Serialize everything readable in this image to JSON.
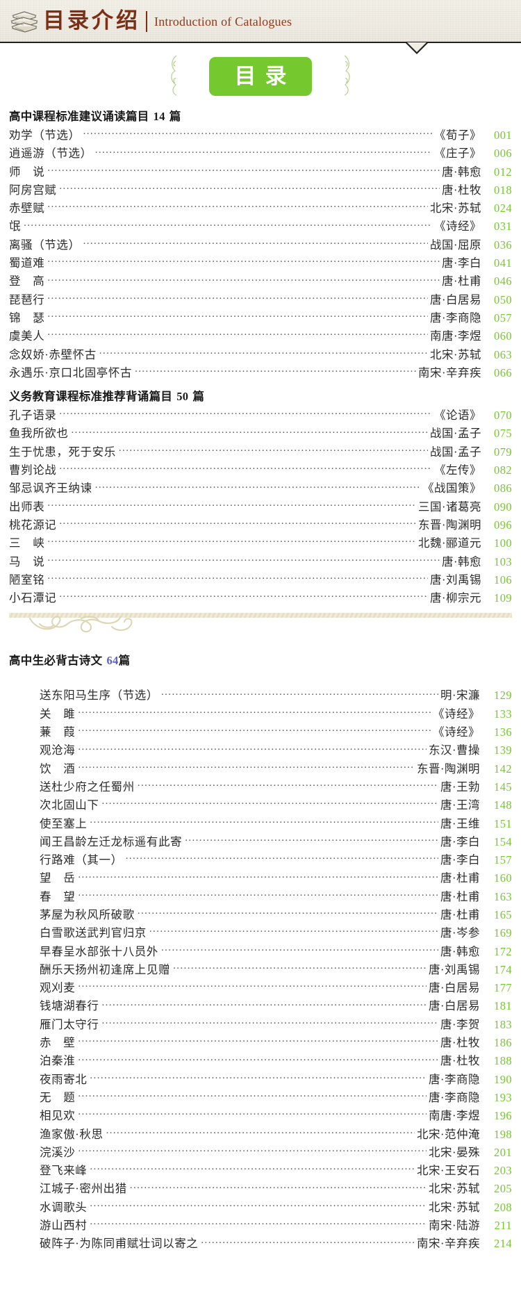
{
  "banner": {
    "title_cn": "目录介绍",
    "title_en": "Introduction of Catalogues",
    "books_icon": "stacked-books-icon"
  },
  "badge": {
    "label": "目录"
  },
  "colors": {
    "green": "#76c82f",
    "brand_brown": "#7b2f16",
    "accent_blue": "#5d5fc8"
  },
  "sections": [
    {
      "title_prefix": "高中课程标准建议诵读篇目 ",
      "title_num": "14",
      "title_suffix": " 篇",
      "entries": [
        {
          "title": "劝学（节选）",
          "author": "《荀子》",
          "page": "001"
        },
        {
          "title": "逍遥游（节选）",
          "author": "《庄子》",
          "page": "006"
        },
        {
          "title": "师　说",
          "author": "唐·韩愈",
          "page": "012"
        },
        {
          "title": "阿房宫赋",
          "author": "唐·杜牧",
          "page": "018"
        },
        {
          "title": "赤壁赋",
          "author": "北宋·苏轼",
          "page": "024"
        },
        {
          "title": "氓",
          "author": "《诗经》",
          "page": "031"
        },
        {
          "title": "离骚（节选）",
          "author": "战国·屈原",
          "page": "036"
        },
        {
          "title": "蜀道难",
          "author": "唐·李白",
          "page": "041"
        },
        {
          "title": "登　高",
          "author": "唐·杜甫",
          "page": "046"
        },
        {
          "title": "琵琶行",
          "author": "唐·白居易",
          "page": "050"
        },
        {
          "title": "锦　瑟",
          "author": "唐·李商隐",
          "page": "057"
        },
        {
          "title": "虞美人",
          "author": "南唐·李煜",
          "page": "060"
        },
        {
          "title": "念奴娇·赤壁怀古",
          "author": "北宋·苏轼",
          "page": "063"
        },
        {
          "title": "永遇乐·京口北固亭怀古",
          "author": "南宋·辛弃疾",
          "page": "066"
        }
      ]
    },
    {
      "title_prefix": "义务教育课程标准推荐背诵篇目 ",
      "title_num": "50",
      "title_suffix": " 篇",
      "entries": [
        {
          "title": "孔子语录",
          "author": "《论语》",
          "page": "070"
        },
        {
          "title": "鱼我所欲也",
          "author": "战国·孟子",
          "page": "075"
        },
        {
          "title": "生于忧患，死于安乐",
          "author": "战国·孟子",
          "page": "079"
        },
        {
          "title": "曹刿论战",
          "author": "《左传》",
          "page": "082"
        },
        {
          "title": "邹忌讽齐王纳谏",
          "author": "《战国策》",
          "page": "086"
        },
        {
          "title": "出师表",
          "author": "三国·诸葛亮",
          "page": "090"
        },
        {
          "title": "桃花源记",
          "author": "东晋·陶渊明",
          "page": "096"
        },
        {
          "title": "三　峡",
          "author": "北魏·郦道元",
          "page": "100"
        },
        {
          "title": "马　说",
          "author": "唐·韩愈",
          "page": "103"
        },
        {
          "title": "陋室铭",
          "author": "唐·刘禹锡",
          "page": "106"
        },
        {
          "title": "小石潭记",
          "author": "唐·柳宗元",
          "page": "109"
        }
      ]
    },
    {
      "title_prefix": "高中生必背古诗文 ",
      "title_num": "64",
      "title_suffix": "篇",
      "entries": [
        {
          "title": "送东阳马生序（节选）",
          "author": "明·宋濂",
          "page": "129"
        },
        {
          "title": "关　雎",
          "author": "《诗经》",
          "page": "133"
        },
        {
          "title": "蒹　葭",
          "author": "《诗经》",
          "page": "136"
        },
        {
          "title": "观沧海",
          "author": "东汉·曹操",
          "page": "139"
        },
        {
          "title": "饮　酒",
          "author": "东晋·陶渊明",
          "page": "142"
        },
        {
          "title": "送杜少府之任蜀州",
          "author": "唐·王勃",
          "page": "145"
        },
        {
          "title": "次北固山下",
          "author": "唐·王湾",
          "page": "148"
        },
        {
          "title": "使至塞上",
          "author": "唐·王维",
          "page": "151"
        },
        {
          "title": "闻王昌龄左迁龙标遥有此寄",
          "author": "唐·李白",
          "page": "154"
        },
        {
          "title": "行路难（其一）",
          "author": "唐·李白",
          "page": "157"
        },
        {
          "title": "望　岳",
          "author": "唐·杜甫",
          "page": "160"
        },
        {
          "title": "春　望",
          "author": "唐·杜甫",
          "page": "163"
        },
        {
          "title": "茅屋为秋风所破歌",
          "author": "唐·杜甫",
          "page": "165"
        },
        {
          "title": "白雪歌送武判官归京",
          "author": "唐·岑参",
          "page": "169"
        },
        {
          "title": "早春呈水部张十八员外",
          "author": "唐·韩愈",
          "page": "172"
        },
        {
          "title": "酬乐天扬州初逢席上见赠",
          "author": "唐·刘禹锡",
          "page": "174"
        },
        {
          "title": "观刈麦",
          "author": "唐·白居易",
          "page": "177"
        },
        {
          "title": "钱塘湖春行",
          "author": "唐·白居易",
          "page": "181"
        },
        {
          "title": "雁门太守行",
          "author": "唐·李贺",
          "page": "183"
        },
        {
          "title": "赤　壁",
          "author": "唐·杜牧",
          "page": "186"
        },
        {
          "title": "泊秦淮",
          "author": "唐·杜牧",
          "page": "188"
        },
        {
          "title": "夜雨寄北",
          "author": "唐·李商隐",
          "page": "190"
        },
        {
          "title": "无　题",
          "author": "唐·李商隐",
          "page": "193"
        },
        {
          "title": "相见欢",
          "author": "南唐·李煜",
          "page": "196"
        },
        {
          "title": "渔家傲·秋思",
          "author": "北宋·范仲淹",
          "page": "198"
        },
        {
          "title": "浣溪沙",
          "author": "北宋·晏殊",
          "page": "201"
        },
        {
          "title": "登飞来峰",
          "author": "北宋·王安石",
          "page": "203"
        },
        {
          "title": "江城子·密州出猎",
          "author": "北宋·苏轼",
          "page": "205"
        },
        {
          "title": "水调歌头",
          "author": "北宋·苏轼",
          "page": "208"
        },
        {
          "title": "游山西村",
          "author": "南宋·陆游",
          "page": "211"
        },
        {
          "title": "破阵子·为陈同甫赋壮词以寄之",
          "author": "南宋·辛弃疾",
          "page": "214"
        }
      ]
    }
  ]
}
